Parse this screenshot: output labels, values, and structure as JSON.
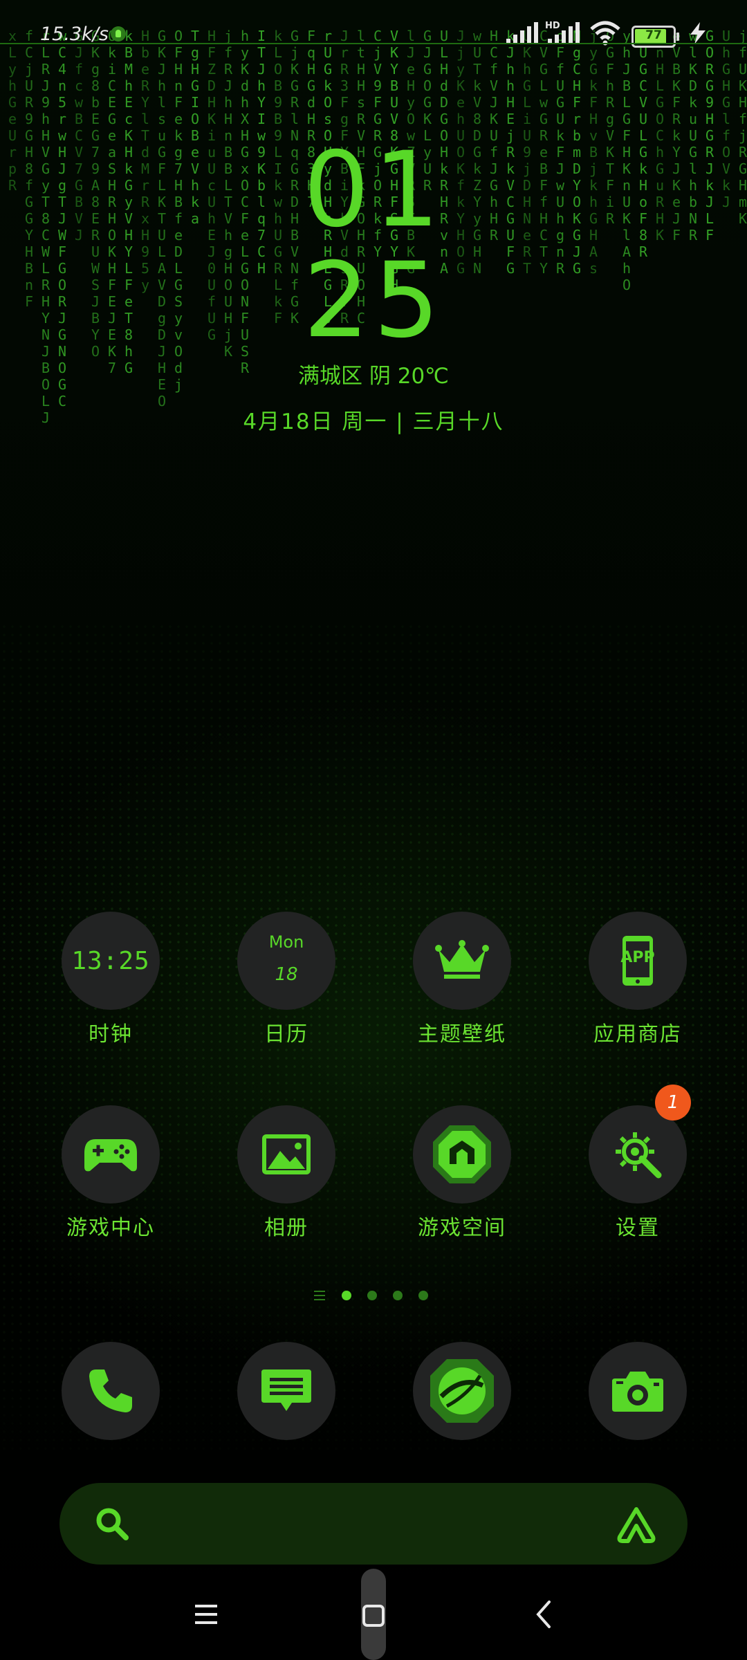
{
  "status_bar": {
    "net_speed": "15.3k/s",
    "network_badge": "HD",
    "battery_level": "77",
    "battery_fraction": 0.77,
    "icons": [
      "notification-icon",
      "signal-icon",
      "signal-hd-icon",
      "wifi-icon",
      "battery-icon",
      "charging-icon"
    ]
  },
  "clock_widget": {
    "hour": "01",
    "minute": "25",
    "weather": "满城区  阴 20℃",
    "date": "4月18日  周一 | 三月十八"
  },
  "apps_row1": [
    {
      "label": "时钟",
      "icon": "clock-icon",
      "icon_text": "13:25"
    },
    {
      "label": "日历",
      "icon": "calendar-icon",
      "day": "Mon",
      "date": "18"
    },
    {
      "label": "主题壁纸",
      "icon": "crown-icon"
    },
    {
      "label": "应用商店",
      "icon": "app-store-icon",
      "icon_text": "APP"
    }
  ],
  "apps_row2": [
    {
      "label": "游戏中心",
      "icon": "gamepad-icon"
    },
    {
      "label": "相册",
      "icon": "gallery-icon"
    },
    {
      "label": "游戏空间",
      "icon": "game-space-icon"
    },
    {
      "label": "设置",
      "icon": "settings-icon",
      "badge": "1"
    }
  ],
  "dock": [
    {
      "name": "phone",
      "icon": "phone-icon"
    },
    {
      "name": "messages",
      "icon": "message-icon"
    },
    {
      "name": "browser",
      "icon": "browser-icon"
    },
    {
      "name": "camera",
      "icon": "camera-icon"
    }
  ],
  "page_indicator": {
    "pages": 4,
    "active": 1
  },
  "colors": {
    "accent": "#58D828",
    "icon_bg": "#222323",
    "badge": "#F0581C",
    "background": "#000000"
  },
  "rain_columns": [
    "xLyhGeUrpR9BVRLyyQKhfGgoFoFoRGRVkTULGXWTGvBrLYUI",
    "fCjUR9GH8fGGYHBnFGRGEKRBLDOOiuU",
    "rLRJ9hHVGyT8CWLRHYNJBOLJFHKGlEOUN",
    "wC4n5rwHJgTJWFGORJGNOGC",
    "GJfcwBCV7GBVJLBLJR9",
    "GKg8bEG79A8ERUWSJBYOLHT7W",
    "OkiCEGeaSHRHOKHFEJEK7",
    "kBMhEcKHkGyVHYLFeT8hG",
    "HbeRYlTdMrRxH95yHRYqlk",
    "GKJhlsuGFLKTULAVDgDJHEOR",
    "OFHnFekg7HBfeDLGSyvOdj",
    "TgHGIOBeVhkaTBFeKeJURb7Vl",
    "HFZDHKiuUcUhEJ0UfUGlY",
    "jfRJhHnBBLTVhgHOUHjK",
    "hyKdhXHGxOCFeLGONFUSR",
    "ITJhYIw9Kblq7CHTnNUsg",
    "kLOB9B9LIkwhUGRLkF",
    "GjKGRlNqGRDHBVNfGK",
    "FqHGdHR83H7BRDRjYgO",
    "rUGkOsOHydHhRHEGLJgtF",
    "JrR3FgFYBiYbVd9RTR",
    "ltHHsRVHFkGOHRUOHC",
    "CjV9FGRGjORkfYo8G",
    "VKYBUV8KGHFSGYGH",
    "lJeHyOwZVRSFBKG",
    "GJGOGKLyURHFTgLV",
    "ULHdDGOHkRHRvnA",
    "JjyKehUOKfkYHOG",
    "wUTkV8DGkZYyGHN",
    "HCfVJKUfJGhHRJF",
    "kJhhHEjRkVCGUFG",
    "UKhGLiU9jDHNeRT",
    "CVGLwGReBFfHCTY",
    "oFfUGUkFJwUhgnR",
    "NgCHFrbmDYOKGJG",
    "jyGkFHvBjkhGHAs",
    "OGFhRgVKTFiRFOYY",
    "yhJBLGFHKnUKlAhO",
    "lUGCVULGkHoF8R",
    "CnHLGOChGuRHK",
    "eVBKFRkYJKeJF",
    "wlKDkuUGlhbNR",
    "GORG9HGRJkJLF",
    "UhGHGlfOVkJC",
    "jfUKHfjRGHmK"
  ]
}
